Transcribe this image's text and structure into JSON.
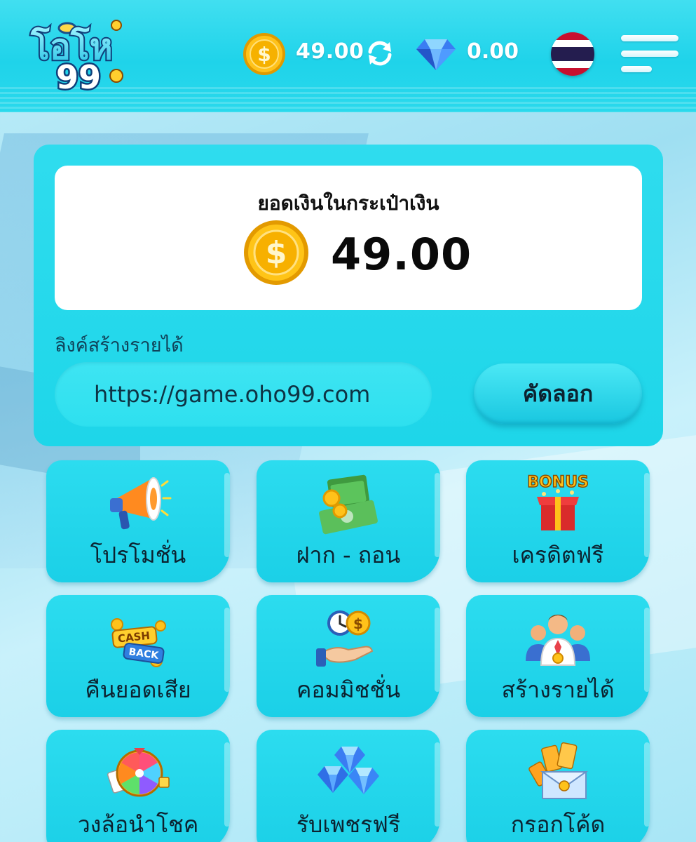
{
  "header": {
    "logo_text": "โอโห99",
    "coin_balance": "49.00",
    "diamond_balance": "0.00"
  },
  "wallet": {
    "title": "ยอดเงินในกระเป๋าเงิน",
    "amount": "49.00"
  },
  "referral": {
    "label": "ลิงค์สร้างรายได้",
    "link": "https://game.oho99.com",
    "copy_label": "คัดลอก"
  },
  "menu_tiles": [
    {
      "label": "โปรโมชั่น",
      "icon": "megaphone-icon"
    },
    {
      "label": "ฝาก - ถอน",
      "icon": "money-stack-icon"
    },
    {
      "label": "เครดิตฟรี",
      "icon": "bonus-gift-icon"
    },
    {
      "label": "คืนยอดเสีย",
      "icon": "cashback-icon"
    },
    {
      "label": "คอมมิชชั่น",
      "icon": "commission-icon"
    },
    {
      "label": "สร้างรายได้",
      "icon": "team-icon"
    },
    {
      "label": "วงล้อนำโชค",
      "icon": "lucky-wheel-icon"
    },
    {
      "label": "รับเพชรฟรี",
      "icon": "diamond-icon"
    },
    {
      "label": "กรอกโค้ด",
      "icon": "coupon-envelope-icon"
    }
  ],
  "colors": {
    "primary": "#1fd3ea",
    "coin_gold": "#f5b400",
    "text_dark": "#0c2230"
  }
}
